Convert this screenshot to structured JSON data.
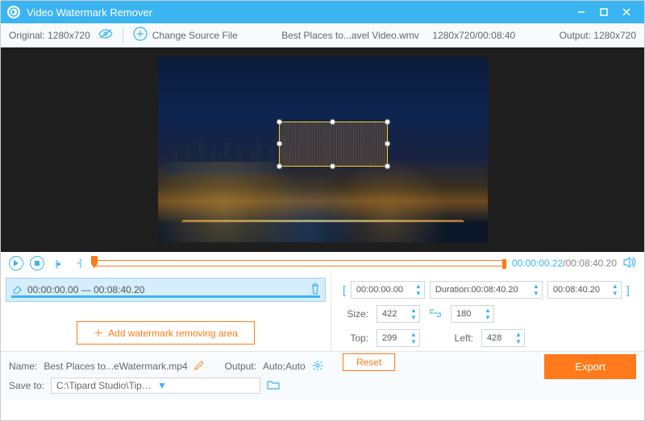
{
  "title": "Video Watermark Remover",
  "infobar": {
    "original_label": "Original:",
    "original_res": "1280x720",
    "change_source": "Change Source File",
    "filename": "Best Places to...avel Video.wmv",
    "file_meta": "1280x720/00:08:40",
    "output_label": "Output:",
    "output_res": "1280x720"
  },
  "playback": {
    "current": "00:00:00.22",
    "sep": "/",
    "total": "00:08:40.20"
  },
  "segment": {
    "start": "00:00:00.00",
    "dash": " — ",
    "end": "00:08:40.20"
  },
  "add_area": "Add watermark removing area",
  "range": {
    "start": "00:00:00.00",
    "dur_label": "Duration:",
    "dur": "00:08:40.20",
    "end": "00:08:40.20"
  },
  "size": {
    "label": "Size:",
    "w": "422",
    "h": "180"
  },
  "pos": {
    "top_label": "Top:",
    "top": "299",
    "left_label": "Left:",
    "left": "428"
  },
  "reset": "Reset",
  "footer": {
    "name_label": "Name:",
    "name": "Best Places to...eWatermark.mp4",
    "output_label": "Output:",
    "output": "Auto;Auto",
    "save_label": "Save to:",
    "save_path": "C:\\Tipard Studio\\Tipar...ideo Watermark Remover",
    "export": "Export"
  }
}
